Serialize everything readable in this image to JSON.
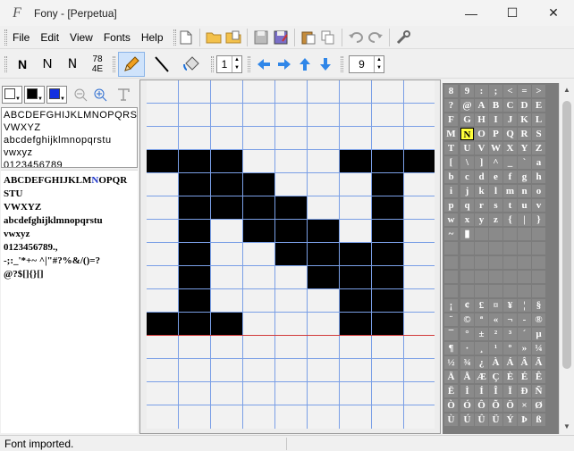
{
  "window": {
    "app_name": "Fony",
    "title": "Fony - [Perpetua]",
    "minimize": "—",
    "maximize": "☐",
    "close": "✕"
  },
  "menu": [
    "File",
    "Edit",
    "View",
    "Fonts",
    "Help"
  ],
  "toolbar_icons": [
    "new-file-icon",
    "open-folder-icon",
    "open-icon",
    "save-icon",
    "save-as-icon",
    "paste-icon",
    "copy-icon",
    "undo-icon",
    "redo-icon",
    "settings-wrench-icon"
  ],
  "toolbar2": {
    "n_buttons": [
      "N",
      "N",
      "N"
    ],
    "char_code": [
      "78",
      "4E"
    ],
    "tools": [
      "pencil-icon",
      "line-icon",
      "fill-icon"
    ],
    "pen_size": "1",
    "arrows": [
      "arrow-left-icon",
      "arrow-right-icon",
      "arrow-up-icon",
      "arrow-down-icon"
    ],
    "font_size": "9"
  },
  "preview_small": [
    "ABCDEFGHIJKLMNOPQRSTU",
    "VWXYZ",
    "abcdefghijklmnopqrstu",
    "vwxyz",
    "0123456789"
  ],
  "preview_large": {
    "line1_a": "ABCDEFGHIJKLM",
    "line1_hl": "N",
    "line1_b": "OPQR",
    "lines": [
      "STU",
      "VWXYZ",
      "abcdefghijklmnopqrstu",
      "vwxyz",
      "0123456789.,",
      "-;:_'*+~ ^|\"#?%&/()=?",
      "@?$[]{}[]"
    ]
  },
  "glyph": {
    "rows": [
      "000000000",
      "000000000",
      "000000000",
      "111000111",
      "011100010",
      "011110010",
      "010111010",
      "010011110",
      "010001110",
      "010000110",
      "111000110",
      "000000000",
      "000000000",
      "000000000",
      "000000000"
    ]
  },
  "charmap": {
    "rows": [
      [
        "8",
        "9",
        ":",
        ";",
        "<",
        "=",
        ">"
      ],
      [
        "?",
        "@",
        "A",
        "B",
        "C",
        "D",
        "E"
      ],
      [
        "F",
        "G",
        "H",
        "I",
        "J",
        "K",
        "L"
      ],
      [
        "M",
        "N",
        "O",
        "P",
        "Q",
        "R",
        "S"
      ],
      [
        "T",
        "U",
        "V",
        "W",
        "X",
        "Y",
        "Z"
      ],
      [
        "[",
        "\\",
        "]",
        "^",
        "_",
        "`",
        "a"
      ],
      [
        "b",
        "c",
        "d",
        "e",
        "f",
        "g",
        "h"
      ],
      [
        "i",
        "j",
        "k",
        "l",
        "m",
        "n",
        "o"
      ],
      [
        "p",
        "q",
        "r",
        "s",
        "t",
        "u",
        "v"
      ],
      [
        "w",
        "x",
        "y",
        "z",
        "{",
        "|",
        "}"
      ],
      [
        "~",
        "▮",
        "",
        "",
        "",
        "",
        ""
      ],
      [
        "",
        "",
        "",
        "",
        "",
        "",
        ""
      ],
      [
        "",
        "",
        "",
        "",
        "",
        "",
        ""
      ],
      [
        "",
        "",
        "",
        "",
        "",
        "",
        ""
      ],
      [
        "",
        "",
        "",
        "",
        "",
        "",
        ""
      ],
      [
        "¡",
        "¢",
        "£",
        "¤",
        "¥",
        "¦",
        "§"
      ],
      [
        "¨",
        "©",
        "ª",
        "«",
        "¬",
        "-",
        "®"
      ],
      [
        "¯",
        "°",
        "±",
        "²",
        "³",
        "´",
        "µ"
      ],
      [
        "¶",
        "·",
        "¸",
        "¹",
        "º",
        "»",
        "¼"
      ],
      [
        "½",
        "¾",
        "¿",
        "À",
        "Á",
        "Â",
        "Ã"
      ],
      [
        "Ä",
        "Å",
        "Æ",
        "Ç",
        "È",
        "É",
        "Ê"
      ],
      [
        "Ë",
        "Ì",
        "Í",
        "Î",
        "Ï",
        "Ð",
        "Ñ"
      ],
      [
        "Ò",
        "Ó",
        "Ô",
        "Õ",
        "Ö",
        "×",
        "Ø"
      ],
      [
        "Ù",
        "Ú",
        "Û",
        "Ü",
        "Ý",
        "Þ",
        "ß"
      ]
    ],
    "selected": "N"
  },
  "status": {
    "text": "Font imported."
  }
}
